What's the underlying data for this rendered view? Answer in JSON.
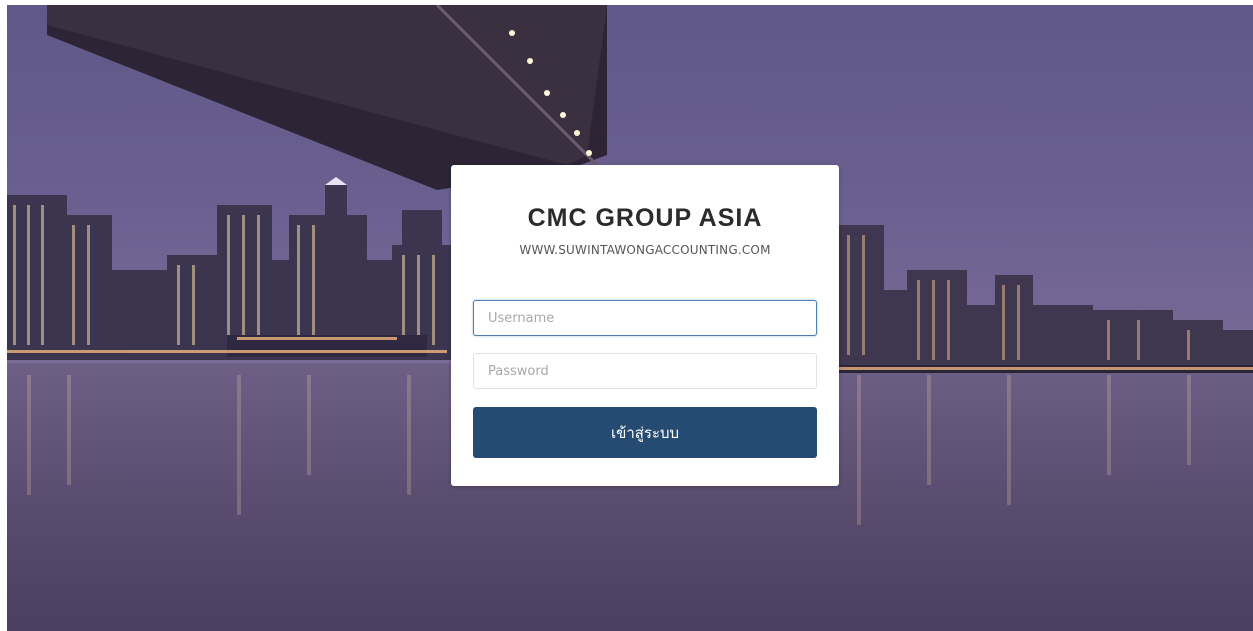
{
  "login": {
    "title": "CMC GROUP ASIA",
    "website": "WWW.SUWINTAWONGACCOUNTING.COM",
    "username_placeholder": "Username",
    "password_placeholder": "Password",
    "submit_label": "เข้าสู่ระบบ"
  },
  "colors": {
    "button_bg": "#264b73",
    "input_focus_border": "#4a7fb5",
    "card_bg": "#ffffff"
  }
}
